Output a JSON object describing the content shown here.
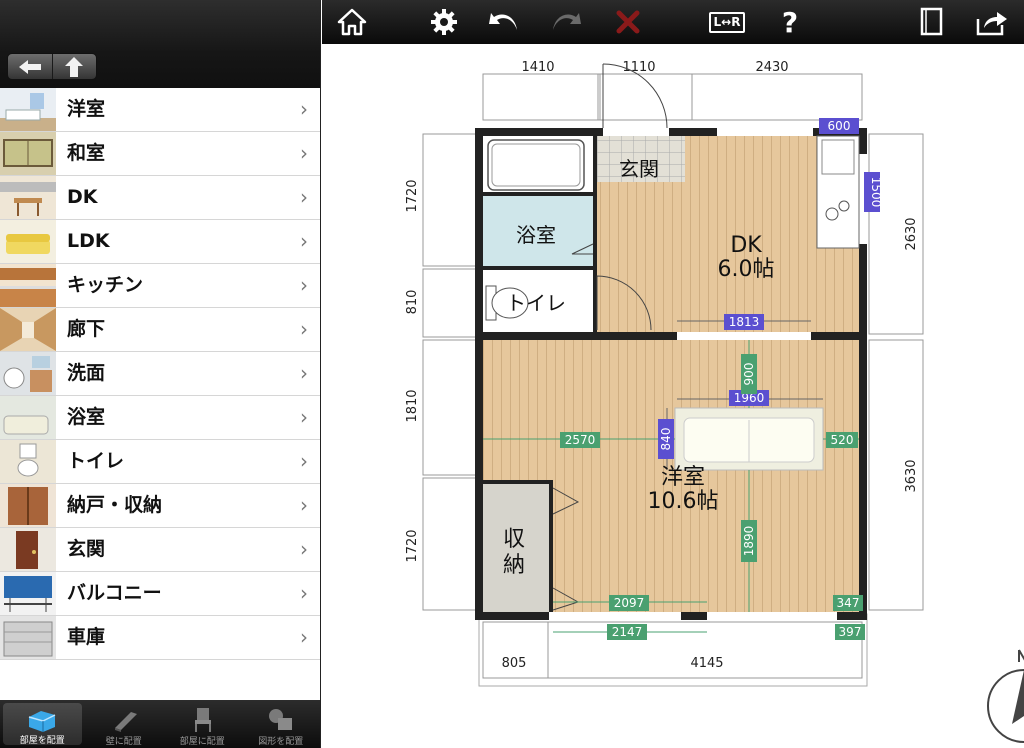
{
  "sidebar": {
    "items": [
      {
        "label": "洋室",
        "chevron": "›",
        "thumb": "bedroom-icon"
      },
      {
        "label": "和室",
        "chevron": "›",
        "thumb": "tatami-room-icon"
      },
      {
        "label": "DK",
        "chevron": "›",
        "thumb": "dining-kitchen-icon"
      },
      {
        "label": "LDK",
        "chevron": "›",
        "thumb": "living-room-icon"
      },
      {
        "label": "キッチン",
        "chevron": "›",
        "thumb": "kitchen-icon"
      },
      {
        "label": "廊下",
        "chevron": "›",
        "thumb": "hallway-icon"
      },
      {
        "label": "洗面",
        "chevron": "›",
        "thumb": "washroom-icon"
      },
      {
        "label": "浴室",
        "chevron": "›",
        "thumb": "bathroom-icon"
      },
      {
        "label": "トイレ",
        "chevron": "›",
        "thumb": "toilet-icon"
      },
      {
        "label": "納戸・収納",
        "chevron": "›",
        "thumb": "closet-icon"
      },
      {
        "label": "玄関",
        "chevron": "›",
        "thumb": "entrance-icon"
      },
      {
        "label": "バルコニー",
        "chevron": "›",
        "thumb": "balcony-icon"
      },
      {
        "label": "車庫",
        "chevron": "›",
        "thumb": "garage-icon"
      }
    ]
  },
  "bottom_tabs": [
    {
      "label": "部屋を配置",
      "active": true
    },
    {
      "label": "壁に配置",
      "active": false
    },
    {
      "label": "部屋に配置",
      "active": false
    },
    {
      "label": "図形を配置",
      "active": false
    }
  ],
  "toolbar": {
    "mirror_label": "L↔R",
    "help_label": "?"
  },
  "plan": {
    "rooms": {
      "entrance": "玄関",
      "bath": "浴室",
      "toilet": "トイレ",
      "dk_name": "DK",
      "dk_size": "6.0帖",
      "western_name": "洋室",
      "western_size": "10.6帖",
      "storage_1": "収",
      "storage_2": "納"
    },
    "dims_top": [
      "1410",
      "1110",
      "2430"
    ],
    "dims_left": [
      "1720",
      "810",
      "1810",
      "1720"
    ],
    "dims_right": [
      "2630",
      "3630"
    ],
    "dims_bottom": [
      "805",
      "4145"
    ],
    "tags_blue": [
      "600",
      "1500",
      "1813",
      "1960",
      "840"
    ],
    "tags_green": [
      "900",
      "2570",
      "520",
      "1890",
      "2097",
      "347",
      "2147",
      "397"
    ]
  },
  "colors": {
    "wall": "#222222",
    "floor_wood": "#e6c79c",
    "bath_floor": "#cfe6ea",
    "storage_floor": "#d6d4cc",
    "entrance_floor": "#e3e0d6",
    "blue_tag": "#5b4fd0",
    "green_tag": "#4aa070"
  }
}
